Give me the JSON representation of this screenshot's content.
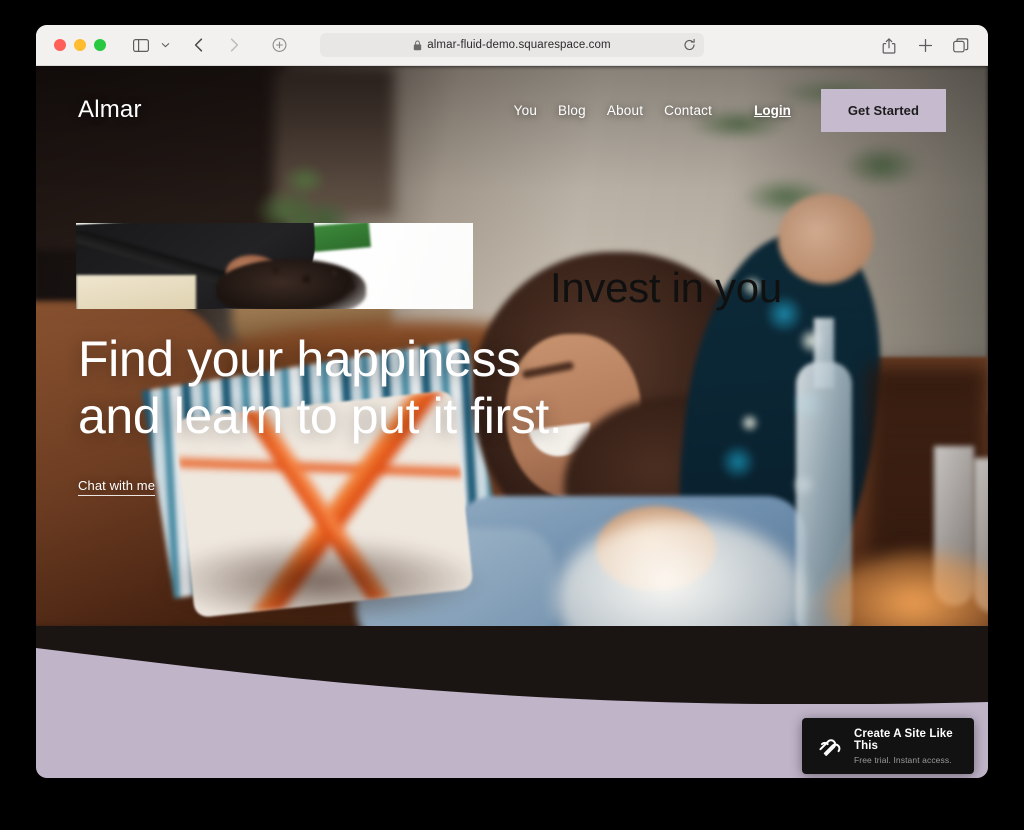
{
  "browser": {
    "url": "almar-fluid-demo.squarespace.com",
    "traffic_lights": [
      "close",
      "minimize",
      "zoom"
    ],
    "toolbar_icons": {
      "sidebar": "sidebar-icon",
      "tab_overview_chevron": "chevron-down-icon",
      "back": "back-arrow-icon",
      "forward": "forward-arrow-icon",
      "shield": "privacy-shield-icon",
      "lock": "lock-icon",
      "reload": "reload-icon",
      "share": "share-icon",
      "new_tab": "plus-icon",
      "tabs": "tabs-icon"
    }
  },
  "site": {
    "brand": "Almar",
    "nav": [
      {
        "label": "You"
      },
      {
        "label": "Blog"
      },
      {
        "label": "About"
      },
      {
        "label": "Contact"
      }
    ],
    "login_label": "Login",
    "cta_button": "Get Started",
    "hero": {
      "title_line1": "Find your happiness",
      "title_line2": "and learn to put it first.",
      "cta_link": "Chat with me"
    },
    "section": {
      "heading": "Invest in you"
    }
  },
  "badge": {
    "title": "Create A Site Like This",
    "subtitle": "Free trial. Instant access.",
    "logo": "squarespace-logo-icon"
  },
  "colors": {
    "accent_purple": "#c0b4c9",
    "button_purple": "#c6bacf",
    "badge_bg": "#121212",
    "page_bg": "#000000"
  }
}
